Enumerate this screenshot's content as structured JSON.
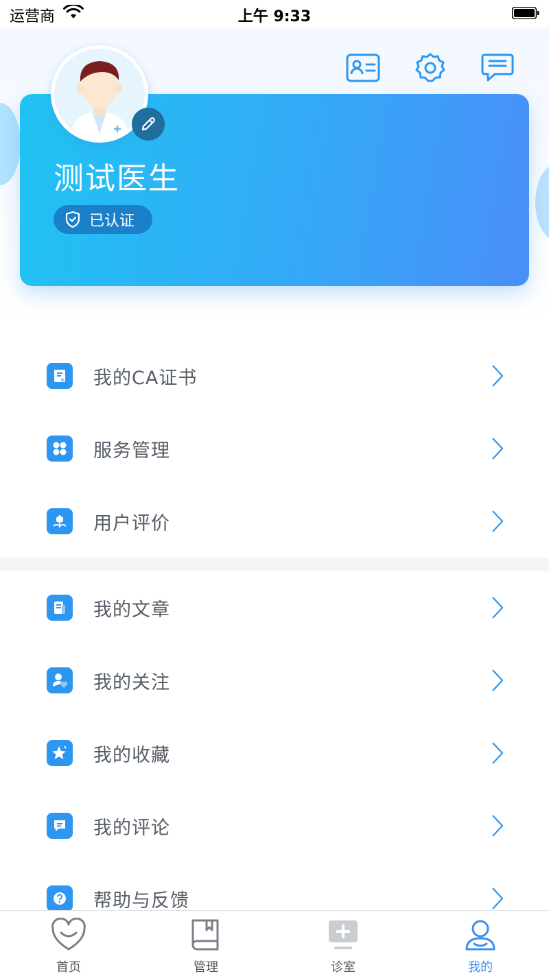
{
  "status_bar": {
    "carrier": "运营商",
    "time": "上午 9:33"
  },
  "header": {
    "icons": [
      "id-card-icon",
      "gear-icon",
      "message-icon"
    ]
  },
  "profile": {
    "name": "测试医生",
    "badge": "已认证"
  },
  "menu": {
    "group1": [
      {
        "label": "我的CA证书",
        "icon": "certificate-icon"
      },
      {
        "label": "服务管理",
        "icon": "grid-icon"
      },
      {
        "label": "用户评价",
        "icon": "flower-icon"
      }
    ],
    "group2": [
      {
        "label": "我的文章",
        "icon": "document-icon"
      },
      {
        "label": "我的关注",
        "icon": "user-heart-icon"
      },
      {
        "label": "我的收藏",
        "icon": "star-icon"
      },
      {
        "label": "我的评论",
        "icon": "comment-icon"
      },
      {
        "label": "帮助与反馈",
        "icon": "help-icon"
      }
    ]
  },
  "tabs": [
    {
      "label": "首页",
      "icon": "heart-icon",
      "active": false
    },
    {
      "label": "管理",
      "icon": "book-icon",
      "active": false
    },
    {
      "label": "诊室",
      "icon": "clinic-icon",
      "active": false
    },
    {
      "label": "我的",
      "icon": "profile-icon",
      "active": true
    }
  ],
  "colors": {
    "accent": "#3b8ff2",
    "card_start": "#20c3f3",
    "card_end": "#4a8ef8"
  }
}
